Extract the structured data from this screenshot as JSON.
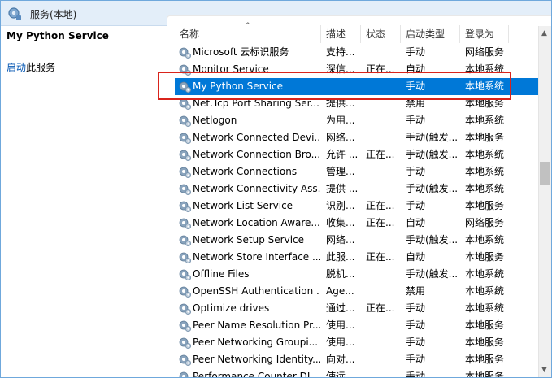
{
  "window": {
    "title": "服务(本地)"
  },
  "left_pane": {
    "service_title": "My Python Service",
    "action_link": "启动",
    "action_suffix": "此服务"
  },
  "columns": [
    "名称",
    "描述",
    "状态",
    "启动类型",
    "登录为"
  ],
  "sort_indicator": "^",
  "rows": [
    {
      "name": "Microsoft 云标识服务",
      "desc": "支持...",
      "status": "",
      "startup": "手动",
      "logon": "网络服务",
      "selected": false
    },
    {
      "name": "Monitor Service",
      "desc": "深信...",
      "status": "正在...",
      "startup": "自动",
      "logon": "本地系统",
      "selected": false
    },
    {
      "name": "My Python Service",
      "desc": "",
      "status": "",
      "startup": "手动",
      "logon": "本地系统",
      "selected": true
    },
    {
      "name": "Net.Tcp Port Sharing Ser...",
      "desc": "提供...",
      "status": "",
      "startup": "禁用",
      "logon": "本地服务",
      "selected": false
    },
    {
      "name": "Netlogon",
      "desc": "为用...",
      "status": "",
      "startup": "手动",
      "logon": "本地系统",
      "selected": false
    },
    {
      "name": "Network Connected Devi...",
      "desc": "网络...",
      "status": "",
      "startup": "手动(触发...",
      "logon": "本地服务",
      "selected": false
    },
    {
      "name": "Network Connection Bro...",
      "desc": "允许 ...",
      "status": "正在...",
      "startup": "手动(触发...",
      "logon": "本地系统",
      "selected": false
    },
    {
      "name": "Network Connections",
      "desc": "管理...",
      "status": "",
      "startup": "手动",
      "logon": "本地系统",
      "selected": false
    },
    {
      "name": "Network Connectivity Ass...",
      "desc": "提供 ...",
      "status": "",
      "startup": "手动(触发...",
      "logon": "本地系统",
      "selected": false
    },
    {
      "name": "Network List Service",
      "desc": "识别...",
      "status": "正在...",
      "startup": "手动",
      "logon": "本地服务",
      "selected": false
    },
    {
      "name": "Network Location Aware...",
      "desc": "收集...",
      "status": "正在...",
      "startup": "自动",
      "logon": "网络服务",
      "selected": false
    },
    {
      "name": "Network Setup Service",
      "desc": "网络...",
      "status": "",
      "startup": "手动(触发...",
      "logon": "本地系统",
      "selected": false
    },
    {
      "name": "Network Store Interface ...",
      "desc": "此服...",
      "status": "正在...",
      "startup": "自动",
      "logon": "本地服务",
      "selected": false
    },
    {
      "name": "Offline Files",
      "desc": "脱机...",
      "status": "",
      "startup": "手动(触发...",
      "logon": "本地系统",
      "selected": false
    },
    {
      "name": "OpenSSH Authentication ...",
      "desc": "Age...",
      "status": "",
      "startup": "禁用",
      "logon": "本地系统",
      "selected": false
    },
    {
      "name": "Optimize drives",
      "desc": "通过...",
      "status": "正在...",
      "startup": "手动",
      "logon": "本地系统",
      "selected": false
    },
    {
      "name": "Peer Name Resolution Pr...",
      "desc": "使用...",
      "status": "",
      "startup": "手动",
      "logon": "本地服务",
      "selected": false
    },
    {
      "name": "Peer Networking Groupi...",
      "desc": "使用...",
      "status": "",
      "startup": "手动",
      "logon": "本地服务",
      "selected": false
    },
    {
      "name": "Peer Networking Identity...",
      "desc": "向对...",
      "status": "",
      "startup": "手动",
      "logon": "本地服务",
      "selected": false
    },
    {
      "name": "Performance Counter DL...",
      "desc": "使远...",
      "status": "",
      "startup": "手动",
      "logon": "本地服务",
      "selected": false
    }
  ],
  "colors": {
    "selection": "#0078d7",
    "highlight_box": "#d9241c",
    "link": "#0b5bb5",
    "titlebar": "#e3eef9"
  },
  "icons": {
    "window": "services-icon",
    "row": "gear-icon"
  }
}
